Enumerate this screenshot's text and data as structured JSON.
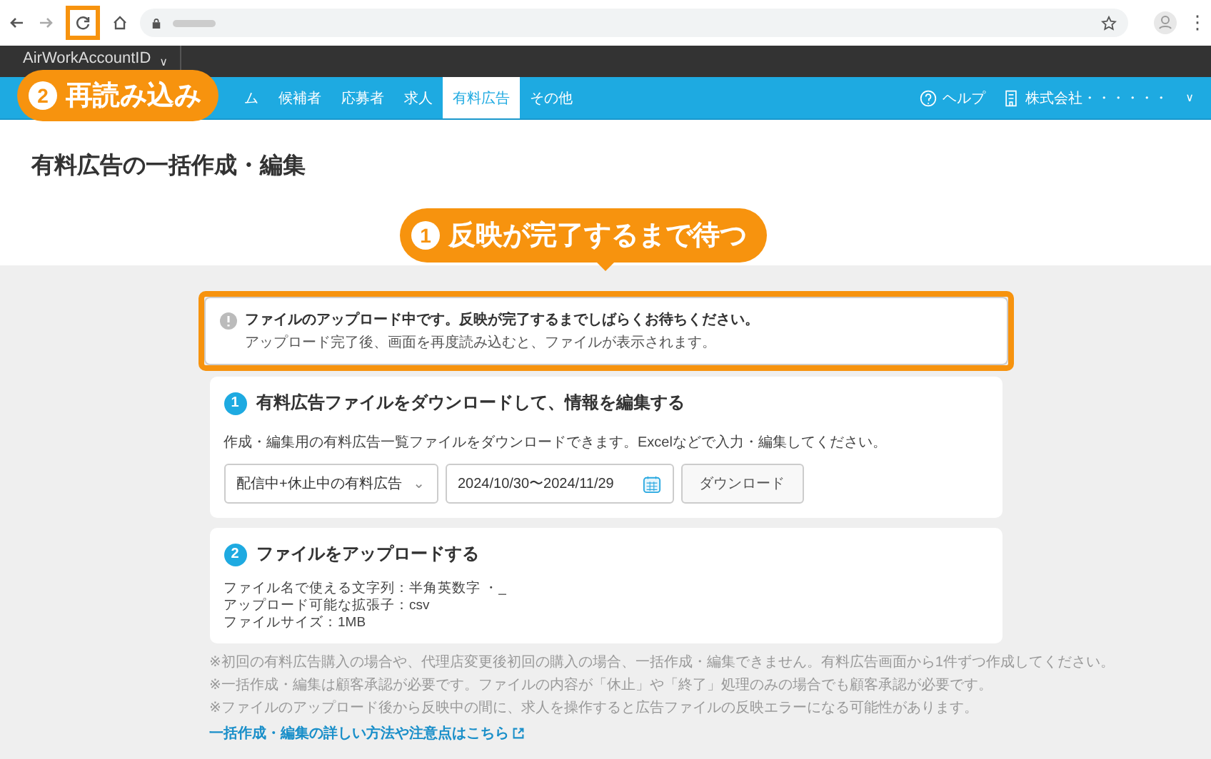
{
  "browser": {
    "menu_glyph": "⋮"
  },
  "account": {
    "name": "AirWorkAccountID",
    "caret": "∨"
  },
  "nav": {
    "items": [
      {
        "label": "ム",
        "selected": false
      },
      {
        "label": "候補者",
        "selected": false
      },
      {
        "label": "応募者",
        "selected": false
      },
      {
        "label": "求人",
        "selected": false
      },
      {
        "label": "有料広告",
        "selected": true
      },
      {
        "label": "その他",
        "selected": false
      }
    ],
    "help": "ヘルプ",
    "company": "株式会社・・・・・・",
    "company_caret": "∨"
  },
  "page_title": "有料広告の一括作成・編集",
  "notice": {
    "title": "ファイルのアップロード中です。反映が完了するまでしばらくお待ちください。",
    "body": "アップロード完了後、画面を再度読み込むと、ファイルが表示されます。"
  },
  "step1": {
    "number": "1",
    "title": "有料広告ファイルをダウンロードして、情報を編集する",
    "description": "作成・編集用の有料広告一覧ファイルをダウンロードできます。Excelなどで入力・編集してください。",
    "select": "配信中+休止中の有料広告",
    "select_caret": "⌄",
    "date_range": "2024/10/30〜2024/11/29",
    "button": "ダウンロード"
  },
  "step2": {
    "number": "2",
    "title": "ファイルをアップロードする",
    "lines": [
      "ファイル名で使える文字列：半角英数字 ・_",
      "アップロード可能な拡張子：csv",
      "ファイルサイズ：1MB"
    ]
  },
  "notes": [
    "※初回の有料広告購入の場合や、代理店変更後初回の購入の場合、一括作成・編集できません。有料広告画面から1件ずつ作成してください。",
    "※一括作成・編集は顧客承認が必要です。ファイルの内容が「休止」や「終了」処理のみの場合でも顧客承認が必要です。",
    "※ファイルのアップロード後から反映中の間に、求人を操作すると広告ファイルの反映エラーになる可能性があります。"
  ],
  "help_link": "一括作成・編集の詳しい方法や注意点はこちら",
  "callouts": [
    {
      "number": "1",
      "text": "反映が完了するまで待つ"
    },
    {
      "number": "2",
      "text": "再読み込み"
    }
  ]
}
